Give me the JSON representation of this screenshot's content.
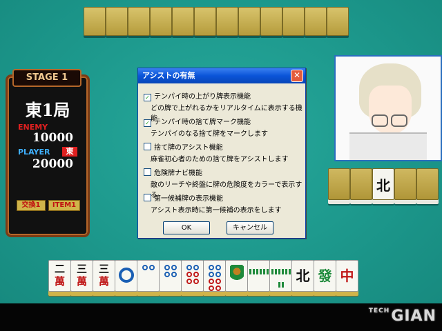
{
  "opponent": {
    "tile_count": 12
  },
  "side_wall": {
    "tiles": [
      "",
      "",
      "北",
      "",
      ""
    ]
  },
  "left_panel": {
    "stage": "STAGE 1",
    "round": "東1局",
    "enemy_label": "ENEMY",
    "enemy_score": "10000",
    "player_label": "PLAYER",
    "player_seat": "東",
    "player_score": "20000",
    "swap_label": "交換1",
    "item_label": "ITEM1"
  },
  "dialog": {
    "title": "アシストの有無",
    "options": [
      {
        "label": "テンパイ時の上がり牌表示機能",
        "checked": true,
        "desc": "どの牌で上がれるかをリアルタイムに表示する機能"
      },
      {
        "label": "テンパイ時の捨て牌マーク機能",
        "checked": true,
        "desc": "テンパイのなる捨て牌をマークします"
      },
      {
        "label": "捨て牌のアシスト機能",
        "checked": false,
        "desc": "麻雀初心者のための捨て牌をアシストします"
      },
      {
        "label": "危険牌ナビ機能",
        "checked": false,
        "desc": "敵のリーチや終盤に牌の危険度をカラーで表示する"
      },
      {
        "label": "第一候補牌の表示機能",
        "checked": false,
        "desc": "アシスト表示時に第一候補の表示をします"
      }
    ],
    "ok_label": "OK",
    "cancel_label": "キャンセル",
    "check_mark": "✓",
    "close_glyph": "✕"
  },
  "hand": [
    {
      "top": "二",
      "bottom": "萬"
    },
    {
      "top": "三",
      "bottom": "萬"
    },
    {
      "top": "三",
      "bottom": "萬"
    },
    {
      "kind": "pin",
      "count": 1
    },
    {
      "kind": "pin",
      "count": 2
    },
    {
      "kind": "pin",
      "count": 4
    },
    {
      "kind": "pin",
      "count": 6
    },
    {
      "kind": "pin",
      "count": 8
    },
    {
      "kind": "sou",
      "count": 1
    },
    {
      "kind": "sou",
      "count": 6
    },
    {
      "kind": "sou",
      "count": 8
    },
    {
      "char": "北",
      "color": "#111111"
    },
    {
      "char": "發",
      "color": "#1e8a3a"
    },
    {
      "char": "中",
      "color": "#c01818"
    }
  ],
  "logo": {
    "small": "TECH",
    "text": "GIAN"
  }
}
